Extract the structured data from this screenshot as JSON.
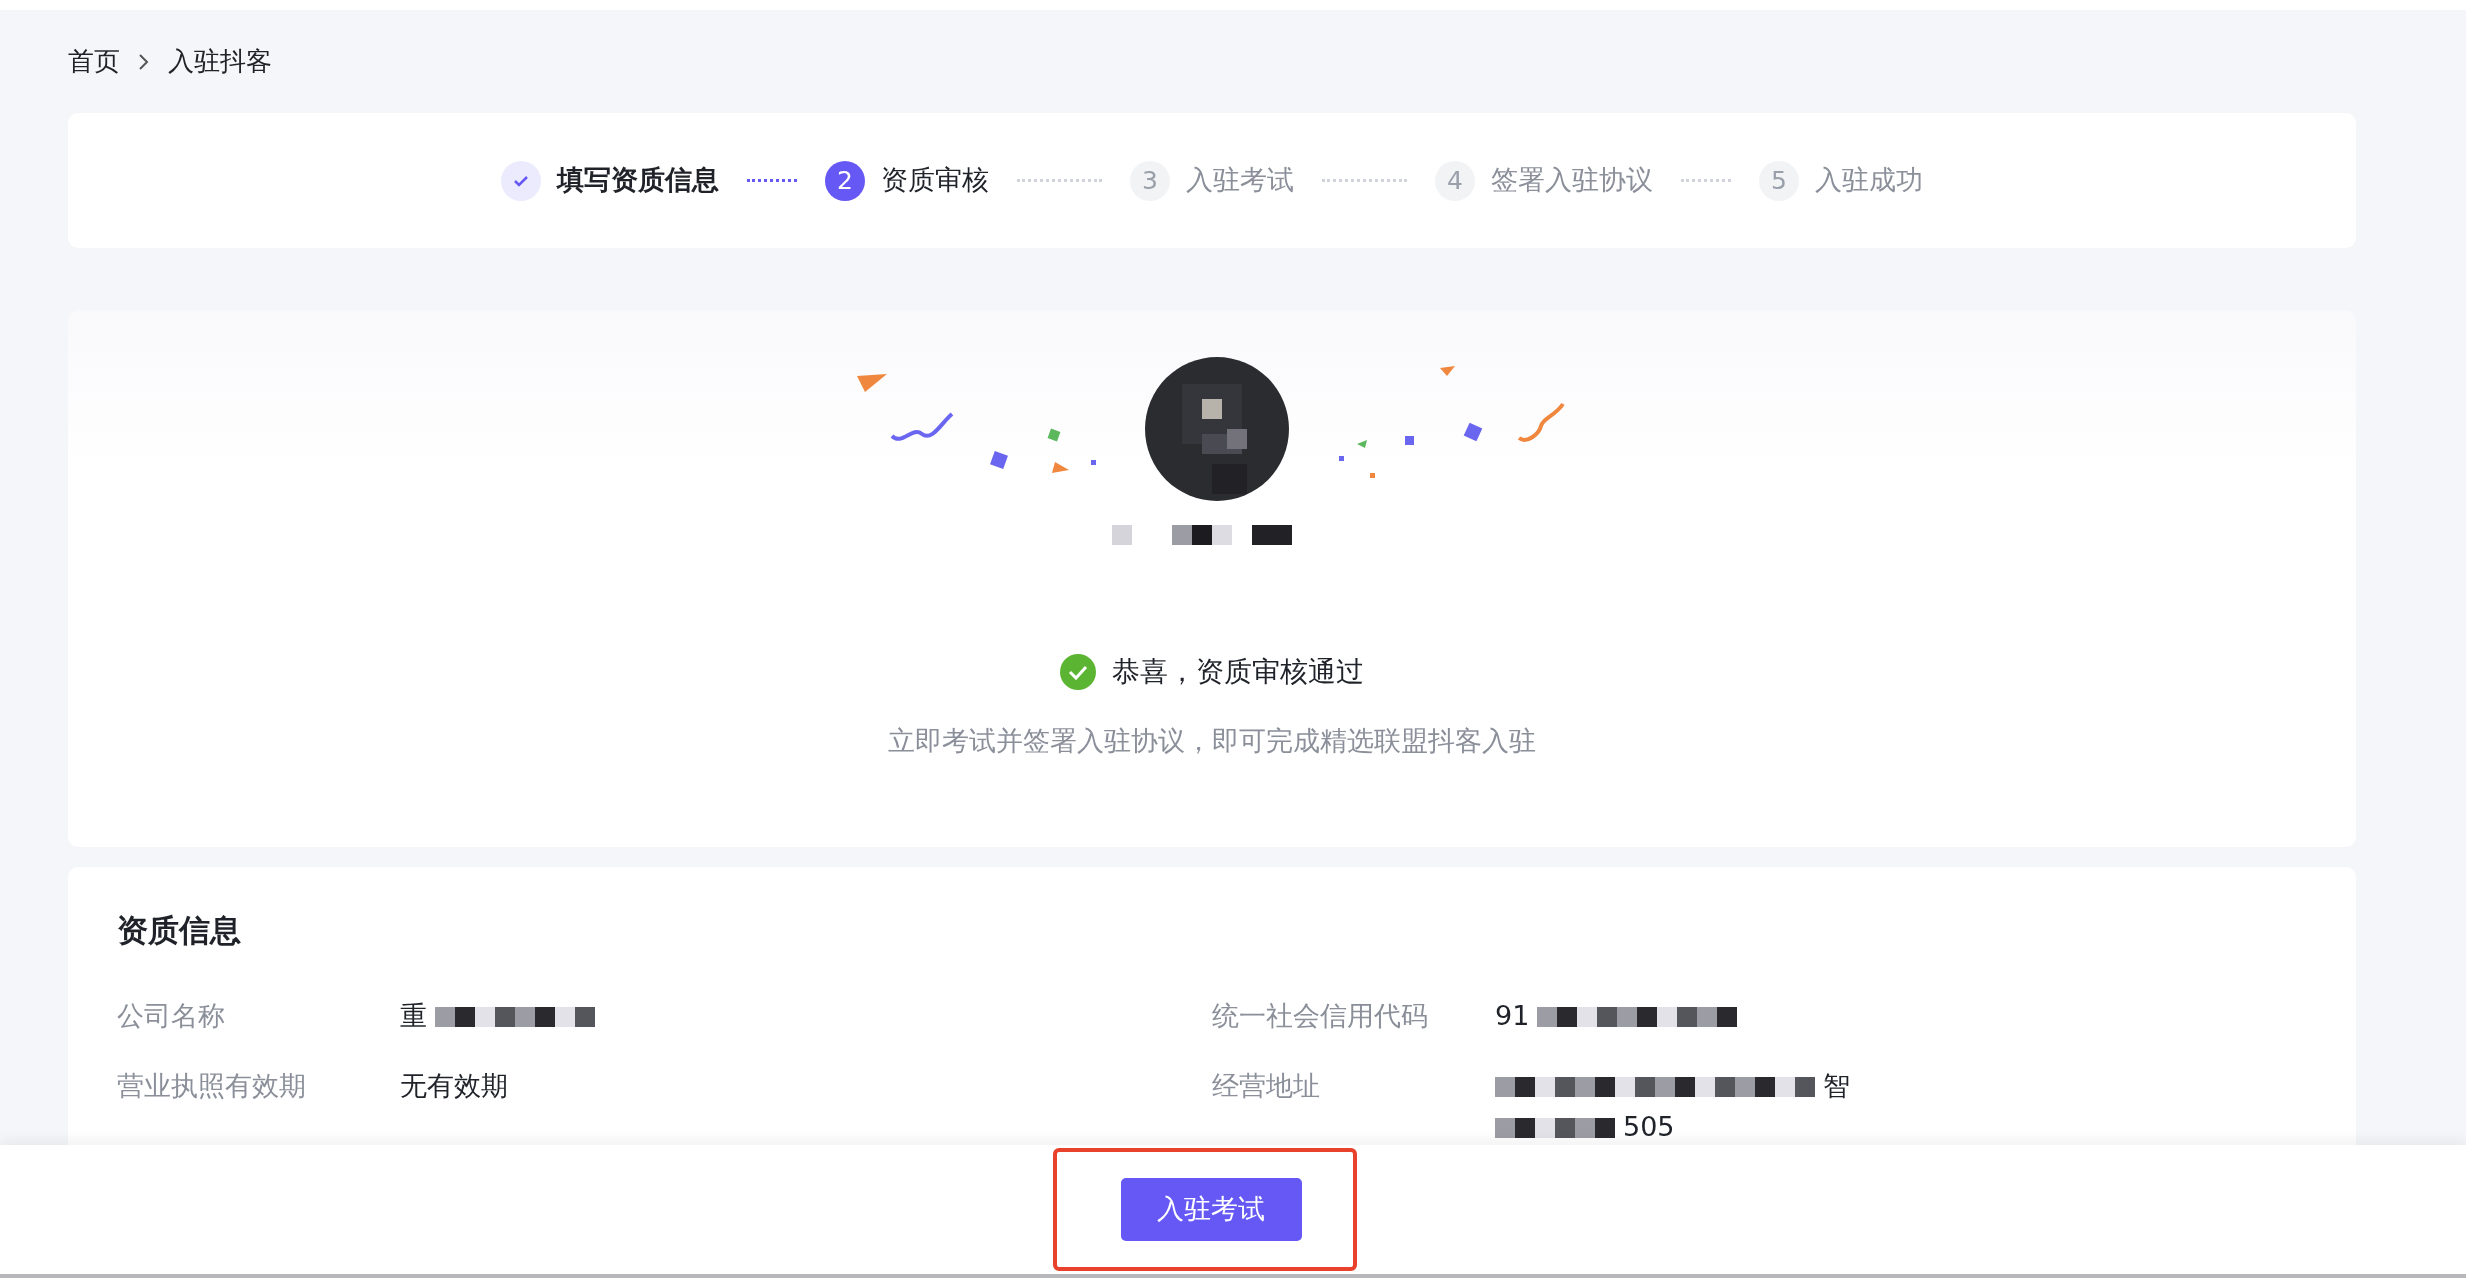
{
  "breadcrumb": [
    {
      "label": "首页"
    },
    {
      "label": "入驻抖客"
    }
  ],
  "steps": [
    {
      "label": "填写资质信息",
      "done": true,
      "selected": false
    },
    {
      "number": "2",
      "label": "资质审核",
      "done": false,
      "selected": true
    },
    {
      "number": "3",
      "label": "入驻考试",
      "done": false,
      "selected": false
    },
    {
      "number": "4",
      "label": "签署入驻协议",
      "done": false,
      "selected": false
    },
    {
      "number": "5",
      "label": "入驻成功",
      "done": false,
      "selected": false
    }
  ],
  "result": {
    "title": "恭喜，资质审核通过",
    "subtitle": "立即考试并签署入驻协议，即可完成精选联盟抖客入驻"
  },
  "info": {
    "title": "资质信息",
    "fields": [
      {
        "label": "公司名称",
        "lines": [
          "重"
        ]
      },
      {
        "label": "统一社会信用代码",
        "lines": [
          "91"
        ]
      },
      {
        "label": "营业执照有效期",
        "lines": [
          "无有效期"
        ]
      },
      {
        "label": "经营地址",
        "lines": [
          "智",
          "505"
        ]
      }
    ]
  },
  "footer": {
    "button": "入驻考试"
  }
}
